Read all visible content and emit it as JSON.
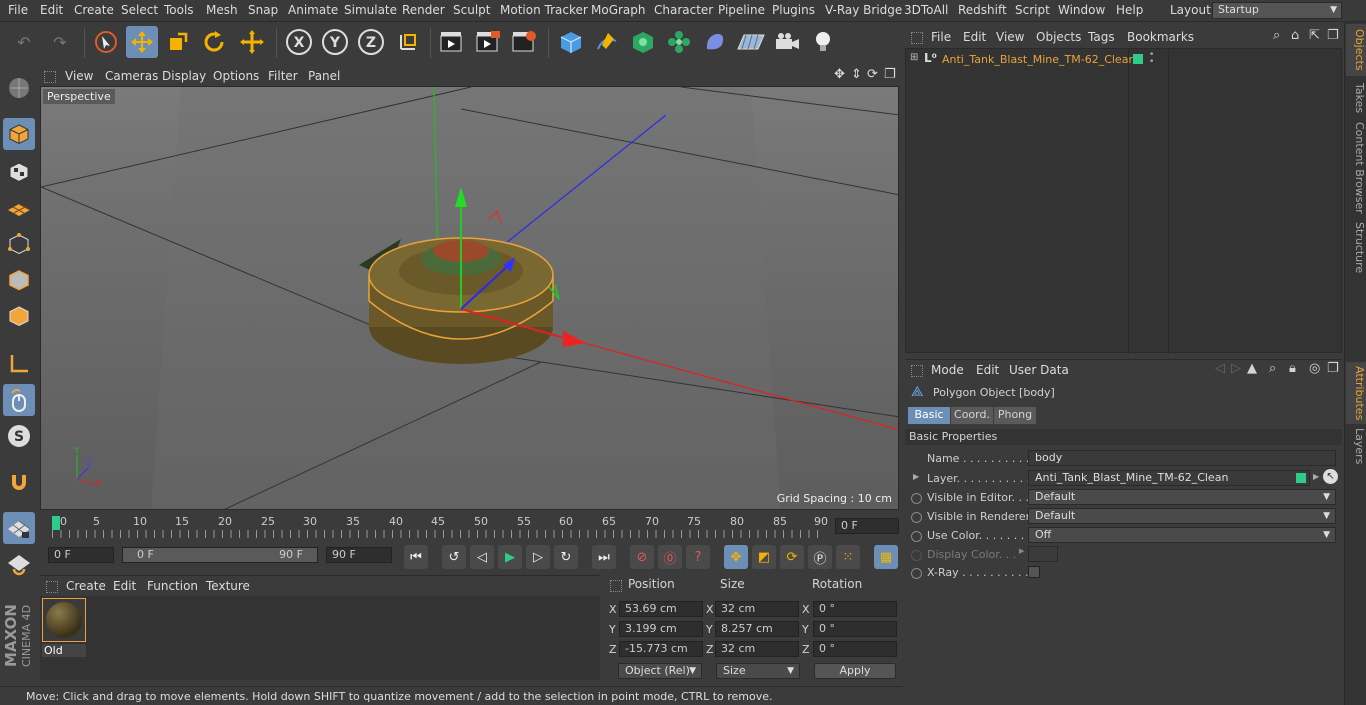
{
  "menubar": {
    "items": [
      "File",
      "Edit",
      "Create",
      "Select",
      "Tools",
      "Mesh",
      "Snap",
      "Animate",
      "Simulate",
      "Render",
      "Sculpt",
      "Motion Tracker",
      "MoGraph",
      "Character",
      "Pipeline",
      "Plugins",
      "V-Ray Bridge",
      "3DToAll",
      "Redshift",
      "Script",
      "Window",
      "Help"
    ],
    "layout_label": "Layout:",
    "layout_value": "Startup"
  },
  "toolbar": {
    "axis_x": "X",
    "axis_y": "Y",
    "axis_z": "Z"
  },
  "viewport": {
    "menu": [
      "View",
      "Cameras",
      "Display",
      "Options",
      "Filter",
      "Panel"
    ],
    "camera_label": "Perspective",
    "grid_spacing": "Grid Spacing : 10 cm"
  },
  "timeline": {
    "ticks": [
      "0",
      "5",
      "10",
      "15",
      "20",
      "25",
      "30",
      "35",
      "40",
      "45",
      "50",
      "55",
      "60",
      "65",
      "70",
      "75",
      "80",
      "85",
      "90"
    ],
    "current_frame": "0 F"
  },
  "controls": {
    "start_frame": "0 F",
    "range_start": "0 F",
    "range_end": "90 F",
    "end_frame": "90 F"
  },
  "materials": {
    "menu": [
      "Create",
      "Edit",
      "Function",
      "Texture"
    ],
    "items": [
      {
        "name": "Old"
      }
    ]
  },
  "coords": {
    "headers": {
      "position": "Position",
      "size": "Size",
      "rotation": "Rotation"
    },
    "rows": [
      {
        "axis": "X",
        "position": "53.69 cm",
        "size": "32 cm",
        "rot_axis": "X",
        "rotation": "0 °"
      },
      {
        "axis": "Y",
        "position": "3.199 cm",
        "size": "8.257 cm",
        "rot_axis": "Y",
        "rotation": "0 °"
      },
      {
        "axis": "Z",
        "position": "-15.773 cm",
        "size": "32 cm",
        "rot_axis": "Z",
        "rotation": "0 °"
      }
    ],
    "mode_select": "Object (Rel)",
    "size_select": "Size",
    "apply": "Apply"
  },
  "status": "Move: Click and drag to move elements. Hold down SHIFT to quantize movement / add to the selection in point mode, CTRL to remove.",
  "object_manager": {
    "menu": [
      "File",
      "Edit",
      "View",
      "Objects",
      "Tags",
      "Bookmarks"
    ],
    "objects": [
      {
        "name": "Anti_Tank_Blast_Mine_TM-62_Clean",
        "layer_color": "#2ecc8a"
      }
    ]
  },
  "attributes": {
    "menu": [
      "Mode",
      "Edit",
      "User Data"
    ],
    "object_title": "Polygon Object [body]",
    "tabs": [
      "Basic",
      "Coord.",
      "Phong"
    ],
    "section": "Basic Properties",
    "name_label": "Name . . . . . . . . . . . .",
    "name_value": "body",
    "layer_label": "Layer. . . . . . . . . . . .",
    "layer_value": "Anti_Tank_Blast_Mine_TM-62_Clean",
    "props": [
      {
        "label": "Visible in Editor. . .",
        "value": "Default"
      },
      {
        "label": "Visible in Renderer",
        "value": "Default"
      },
      {
        "label": "Use Color. . . . . . . .",
        "value": "Off"
      }
    ],
    "display_color_label": "Display Color. . .",
    "xray_label": "X-Ray . . . . . . . . . . ."
  },
  "side_tabs": [
    "Objects",
    "Takes",
    "Content Browser",
    "Structure",
    "Attributes",
    "Layers"
  ],
  "brand": {
    "maxon": "MAXON",
    "product": "CINEMA 4D"
  },
  "colors": {
    "accent": "#6d8fb5",
    "highlight": "#e8a33c",
    "selection_green": "#2ecc8a"
  }
}
